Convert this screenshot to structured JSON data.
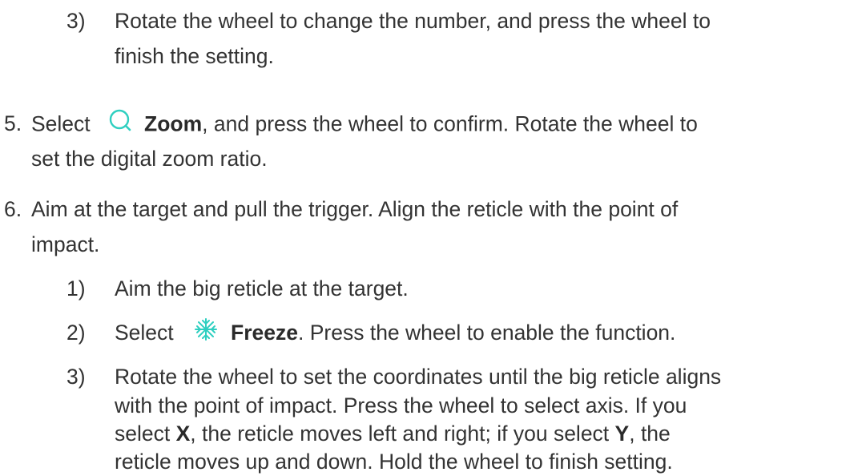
{
  "colors": {
    "text": "#333333",
    "icon": "#2ecfc0"
  },
  "step3_top": {
    "num": "3)",
    "line1": "Rotate the wheel to change the number, and press the wheel to",
    "line2": "finish the setting."
  },
  "step5": {
    "num": "5.",
    "select": "Select",
    "icon": "zoom-icon",
    "bold": "Zoom",
    "rest": ", and press the wheel to confirm. Rotate the wheel to",
    "line2": "set the digital zoom ratio."
  },
  "step6": {
    "num": "6.",
    "line1": "Aim at the target and pull the trigger. Align the reticle with the point of",
    "line2": "impact.",
    "sub1": {
      "num": "1)",
      "text": "Aim the big reticle at the target."
    },
    "sub2": {
      "num": "2)",
      "select": "Select",
      "icon": "freeze-icon",
      "bold": "Freeze",
      "rest": ". Press the wheel to enable the function."
    },
    "sub3": {
      "num": "3)",
      "line1": "Rotate the wheel to set the coordinates until the big reticle aligns",
      "line2": "with the point of impact. Press the wheel to select axis. If you",
      "line3a": "select ",
      "line3b": "X",
      "line3c": ", the reticle moves left and right; if you select ",
      "line3d": "Y",
      "line3e": ", the",
      "line4": "reticle moves up and down. Hold the wheel to finish setting."
    }
  }
}
